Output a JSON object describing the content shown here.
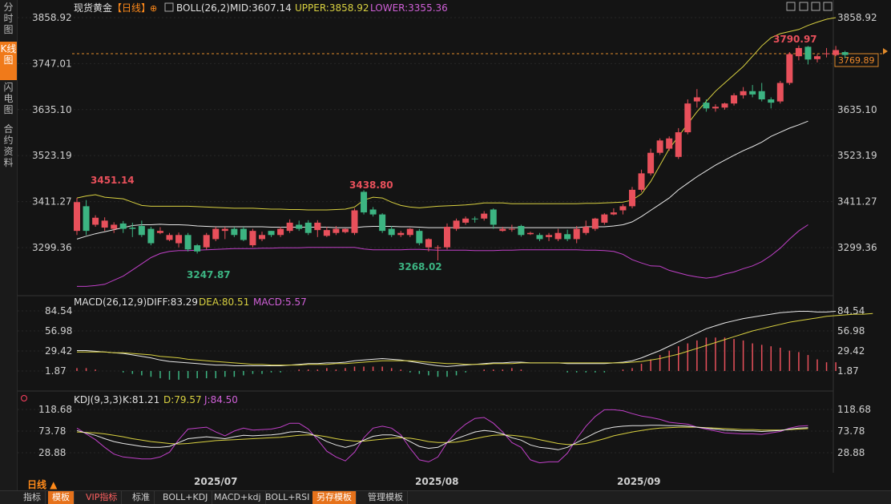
{
  "sidebar": {
    "tabs": [
      {
        "label": "分时图",
        "active": false
      },
      {
        "label": "K线图",
        "active": true
      },
      {
        "label": "闪电图",
        "active": false
      },
      {
        "label": "合约资料",
        "active": false
      }
    ]
  },
  "header": {
    "instrument": "现货黄金",
    "period_tag": "【日线】",
    "indicator_name": "BOLL(26,2)",
    "mid_label": "MID:3607.14",
    "upper_label": "UPPER:3858.92",
    "lower_label": "LOWER:3355.36"
  },
  "price_axis": {
    "ticks": [
      "3858.92",
      "3747.01",
      "3635.10",
      "3523.19",
      "3411.27",
      "3299.36"
    ],
    "current_price": "3769.89"
  },
  "annotations": {
    "high1": "3451.14",
    "high2": "3438.80",
    "high3": "3790.97",
    "low1": "3247.87",
    "low2": "3268.02"
  },
  "macd": {
    "title": "MACD(26,12,9)",
    "diff_label": "DIFF:83.29",
    "dea_label": "DEA:80.51",
    "macd_label": "MACD:5.57",
    "ticks": [
      "84.54",
      "56.98",
      "29.42",
      "1.87"
    ]
  },
  "kdj": {
    "title": "KDJ(9,3,3)",
    "k_label": "K:81.21",
    "d_label": "D:79.57",
    "j_label": "J:84.50",
    "ticks": [
      "118.68",
      "73.78",
      "28.88"
    ]
  },
  "dates": [
    "2025/07",
    "2025/08",
    "2025/09"
  ],
  "period": "日线 ▲",
  "bottom_bar": {
    "items": [
      {
        "label": "指标",
        "style": "normal"
      },
      {
        "label": "模板",
        "style": "orange"
      },
      {
        "label": "VIP指标",
        "style": "red"
      },
      {
        "label": "标准",
        "style": "normal"
      },
      {
        "label": "BOLL+KDJ",
        "style": "normal"
      },
      {
        "label": "MACD+kdj",
        "style": "normal"
      },
      {
        "label": "BOLL+RSI",
        "style": "normal"
      },
      {
        "label": "另存模板",
        "style": "orange"
      },
      {
        "label": "管理模板",
        "style": "normal"
      }
    ]
  },
  "colors": {
    "up": "#e8505b",
    "down": "#3cb482",
    "upper_band": "#d8d040",
    "mid_band": "#e8e8e8",
    "lower_band": "#c040c8",
    "accent": "#f07a1a"
  },
  "chart_data": {
    "type": "candlestick",
    "candles": [
      [
        3340,
        3410,
        3330,
        3420
      ],
      [
        3400,
        3340,
        3330,
        3415
      ],
      [
        3355,
        3372,
        3350,
        3378
      ],
      [
        3348,
        3365,
        3340,
        3373
      ],
      [
        3345,
        3355,
        3335,
        3361
      ],
      [
        3358,
        3345,
        3335,
        3364
      ],
      [
        3348,
        3345,
        3325,
        3360
      ],
      [
        3352,
        3330,
        3325,
        3365
      ],
      [
        3345,
        3310,
        3305,
        3350
      ],
      [
        3335,
        3340,
        3332,
        3349
      ],
      [
        3318,
        3330,
        3315,
        3335
      ],
      [
        3310,
        3330,
        3300,
        3336
      ],
      [
        3330,
        3295,
        3290,
        3335
      ],
      [
        3305,
        3290,
        3285,
        3308
      ],
      [
        3300,
        3330,
        3295,
        3335
      ],
      [
        3320,
        3345,
        3315,
        3350
      ],
      [
        3340,
        3345,
        3320,
        3350
      ],
      [
        3345,
        3330,
        3325,
        3350
      ],
      [
        3345,
        3318,
        3315,
        3350
      ],
      [
        3305,
        3340,
        3300,
        3345
      ],
      [
        3320,
        3330,
        3315,
        3338
      ],
      [
        3340,
        3330,
        3325,
        3340
      ],
      [
        3330,
        3345,
        3325,
        3350
      ],
      [
        3340,
        3360,
        3335,
        3368
      ],
      [
        3355,
        3345,
        3340,
        3365
      ],
      [
        3360,
        3335,
        3330,
        3366
      ],
      [
        3342,
        3360,
        3325,
        3366
      ],
      [
        3328,
        3342,
        3325,
        3350
      ],
      [
        3335,
        3345,
        3330,
        3352
      ],
      [
        3337,
        3345,
        3334,
        3346
      ],
      [
        3335,
        3390,
        3330,
        3395
      ],
      [
        3435,
        3385,
        3380,
        3439
      ],
      [
        3392,
        3380,
        3375,
        3398
      ],
      [
        3380,
        3340,
        3335,
        3383
      ],
      [
        3345,
        3330,
        3325,
        3352
      ],
      [
        3330,
        3335,
        3325,
        3340
      ],
      [
        3330,
        3345,
        3325,
        3347
      ],
      [
        3340,
        3310,
        3305,
        3345
      ],
      [
        3300,
        3320,
        3290,
        3322
      ],
      [
        3300,
        3300,
        3268,
        3305
      ],
      [
        3300,
        3350,
        3295,
        3358
      ],
      [
        3345,
        3365,
        3340,
        3370
      ],
      [
        3360,
        3370,
        3355,
        3375
      ],
      [
        3370,
        3368,
        3360,
        3375
      ],
      [
        3370,
        3382,
        3365,
        3388
      ],
      [
        3392,
        3355,
        3345,
        3395
      ],
      [
        3340,
        3345,
        3338,
        3350
      ],
      [
        3345,
        3345,
        3338,
        3355
      ],
      [
        3352,
        3330,
        3326,
        3355
      ],
      [
        3332,
        3335,
        3330,
        3338
      ],
      [
        3330,
        3320,
        3315,
        3335
      ],
      [
        3325,
        3330,
        3315,
        3335
      ],
      [
        3320,
        3335,
        3315,
        3345
      ],
      [
        3332,
        3320,
        3315,
        3343
      ],
      [
        3320,
        3345,
        3310,
        3352
      ],
      [
        3335,
        3350,
        3330,
        3365
      ],
      [
        3345,
        3370,
        3340,
        3372
      ],
      [
        3360,
        3380,
        3355,
        3383
      ],
      [
        3380,
        3385,
        3378,
        3395
      ],
      [
        3390,
        3400,
        3380,
        3405
      ],
      [
        3400,
        3440,
        3395,
        3447
      ],
      [
        3440,
        3480,
        3435,
        3489
      ],
      [
        3480,
        3530,
        3475,
        3540
      ],
      [
        3530,
        3560,
        3525,
        3565
      ],
      [
        3540,
        3565,
        3535,
        3570
      ],
      [
        3520,
        3580,
        3515,
        3590
      ],
      [
        3580,
        3650,
        3575,
        3660
      ],
      [
        3655,
        3665,
        3640,
        3685
      ],
      [
        3652,
        3638,
        3630,
        3660
      ],
      [
        3638,
        3642,
        3630,
        3648
      ],
      [
        3640,
        3650,
        3635,
        3652
      ],
      [
        3650,
        3670,
        3645,
        3675
      ],
      [
        3670,
        3680,
        3662,
        3690
      ],
      [
        3680,
        3672,
        3665,
        3695
      ],
      [
        3680,
        3660,
        3655,
        3700
      ],
      [
        3660,
        3652,
        3638,
        3665
      ],
      [
        3655,
        3700,
        3650,
        3705
      ],
      [
        3700,
        3770,
        3695,
        3775
      ],
      [
        3765,
        3785,
        3755,
        3791
      ],
      [
        3788,
        3757,
        3745,
        3790
      ],
      [
        3758,
        3765,
        3750,
        3770
      ],
      [
        3770,
        3772,
        3762,
        3785
      ],
      [
        3768,
        3780,
        3765,
        3790
      ],
      [
        3775,
        3768,
        3760,
        3778
      ]
    ],
    "upper": [
      3420,
      3425,
      3428,
      3422,
      3420,
      3418,
      3410,
      3402,
      3400,
      3400,
      3400,
      3400,
      3400,
      3399,
      3398,
      3397,
      3396,
      3395,
      3395,
      3395,
      3394,
      3393,
      3393,
      3392,
      3392,
      3391,
      3391,
      3391,
      3392,
      3393,
      3398,
      3415,
      3422,
      3420,
      3410,
      3402,
      3398,
      3396,
      3398,
      3400,
      3401,
      3402,
      3403,
      3405,
      3408,
      3408,
      3408,
      3406,
      3406,
      3406,
      3406,
      3406,
      3406,
      3406,
      3406,
      3407,
      3407,
      3408,
      3409,
      3410,
      3415,
      3430,
      3460,
      3500,
      3540,
      3570,
      3600,
      3630,
      3655,
      3680,
      3700,
      3720,
      3740,
      3765,
      3790,
      3810,
      3820,
      3825,
      3830,
      3840,
      3848,
      3855,
      3859
    ],
    "mid": [
      3320,
      3327,
      3333,
      3338,
      3343,
      3348,
      3353,
      3355,
      3355,
      3356,
      3355,
      3355,
      3354,
      3352,
      3351,
      3350,
      3350,
      3350,
      3350,
      3350,
      3350,
      3349,
      3349,
      3349,
      3349,
      3349,
      3349,
      3349,
      3348,
      3348,
      3348,
      3350,
      3351,
      3351,
      3351,
      3350,
      3350,
      3349,
      3348,
      3348,
      3348,
      3348,
      3348,
      3348,
      3348,
      3348,
      3348,
      3348,
      3348,
      3348,
      3348,
      3348,
      3348,
      3348,
      3348,
      3350,
      3350,
      3350,
      3352,
      3355,
      3362,
      3375,
      3390,
      3405,
      3420,
      3440,
      3456,
      3472,
      3486,
      3500,
      3512,
      3524,
      3535,
      3545,
      3556,
      3570,
      3580,
      3590,
      3598,
      3607
    ],
    "lower": [
      3205,
      3205,
      3207,
      3210,
      3220,
      3230,
      3245,
      3260,
      3275,
      3285,
      3290,
      3292,
      3292,
      3293,
      3294,
      3295,
      3296,
      3297,
      3297,
      3297,
      3298,
      3298,
      3299,
      3299,
      3299,
      3300,
      3300,
      3300,
      3300,
      3300,
      3300,
      3296,
      3294,
      3294,
      3294,
      3294,
      3295,
      3295,
      3294,
      3293,
      3293,
      3293,
      3293,
      3292,
      3292,
      3292,
      3293,
      3293,
      3294,
      3294,
      3294,
      3294,
      3294,
      3294,
      3294,
      3293,
      3293,
      3292,
      3290,
      3283,
      3270,
      3262,
      3255,
      3254,
      3244,
      3238,
      3232,
      3228,
      3225,
      3228,
      3235,
      3240,
      3248,
      3255,
      3265,
      3280,
      3298,
      3320,
      3340,
      3355
    ],
    "macd_diff": [
      30,
      30,
      29,
      28,
      27,
      26,
      24,
      22,
      20,
      17,
      15,
      14,
      13,
      12,
      11,
      10,
      10,
      9,
      9,
      9,
      9,
      9,
      9,
      10,
      11,
      12,
      12,
      13,
      13,
      14,
      16,
      17,
      18,
      19,
      18,
      17,
      15,
      13,
      11,
      9,
      8,
      9,
      10,
      11,
      12,
      13,
      13,
      14,
      14,
      13,
      13,
      13,
      13,
      12,
      12,
      12,
      12,
      12,
      13,
      14,
      16,
      20,
      25,
      30,
      36,
      42,
      48,
      54,
      60,
      64,
      68,
      71,
      74,
      76,
      78,
      80,
      82,
      83,
      84,
      84,
      83,
      83,
      84
    ],
    "macd_dea": [
      28,
      28,
      28,
      28,
      27,
      27,
      26,
      25,
      24,
      22,
      21,
      20,
      18,
      17,
      16,
      15,
      14,
      13,
      12,
      11,
      11,
      10,
      10,
      10,
      10,
      11,
      11,
      11,
      12,
      12,
      13,
      14,
      15,
      16,
      16,
      16,
      16,
      15,
      14,
      13,
      12,
      12,
      11,
      11,
      11,
      12,
      12,
      12,
      13,
      13,
      13,
      13,
      13,
      13,
      13,
      13,
      13,
      13,
      13,
      13,
      14,
      15,
      17,
      19,
      22,
      25,
      29,
      33,
      37,
      41,
      45,
      49,
      53,
      57,
      60,
      63,
      66,
      69,
      71,
      73,
      75,
      77,
      78,
      79,
      80,
      80,
      81
    ],
    "kdj_k": [
      75,
      70,
      65,
      58,
      52,
      48,
      45,
      42,
      40,
      40,
      42,
      50,
      58,
      60,
      62,
      60,
      58,
      62,
      65,
      64,
      65,
      66,
      68,
      72,
      73,
      70,
      62,
      52,
      45,
      40,
      45,
      55,
      63,
      66,
      66,
      62,
      52,
      42,
      38,
      40,
      50,
      58,
      65,
      72,
      75,
      73,
      68,
      60,
      55,
      45,
      40,
      38,
      35,
      40,
      50,
      60,
      70,
      78,
      82,
      84,
      85,
      85,
      86,
      86,
      85,
      85,
      84,
      82,
      80,
      78,
      76,
      75,
      74,
      74,
      73,
      74,
      75,
      78,
      80,
      81
    ],
    "kdj_d": [
      72,
      71,
      70,
      68,
      65,
      62,
      58,
      55,
      52,
      50,
      48,
      47,
      48,
      50,
      52,
      54,
      55,
      56,
      57,
      58,
      59,
      60,
      61,
      63,
      65,
      66,
      65,
      62,
      58,
      55,
      53,
      53,
      55,
      57,
      59,
      60,
      59,
      56,
      52,
      50,
      50,
      51,
      54,
      58,
      62,
      65,
      66,
      65,
      63,
      60,
      56,
      52,
      48,
      46,
      46,
      48,
      53,
      58,
      64,
      68,
      72,
      75,
      78,
      80,
      81,
      82,
      82,
      82,
      81,
      80,
      79,
      78,
      77,
      77,
      76,
      76,
      76,
      77,
      78,
      79
    ],
    "kdj_j": [
      80,
      68,
      56,
      40,
      26,
      20,
      18,
      16,
      16,
      20,
      30,
      56,
      78,
      80,
      82,
      72,
      64,
      74,
      80,
      76,
      77,
      78,
      82,
      90,
      90,
      78,
      56,
      32,
      20,
      12,
      30,
      60,
      80,
      84,
      80,
      66,
      38,
      14,
      10,
      20,
      50,
      72,
      88,
      100,
      102,
      90,
      72,
      50,
      40,
      14,
      8,
      10,
      10,
      28,
      58,
      84,
      104,
      118,
      118,
      116,
      110,
      105,
      102,
      98,
      92,
      90,
      88,
      82,
      78,
      74,
      70,
      69,
      68,
      68,
      67,
      70,
      73,
      80,
      84,
      85
    ]
  }
}
